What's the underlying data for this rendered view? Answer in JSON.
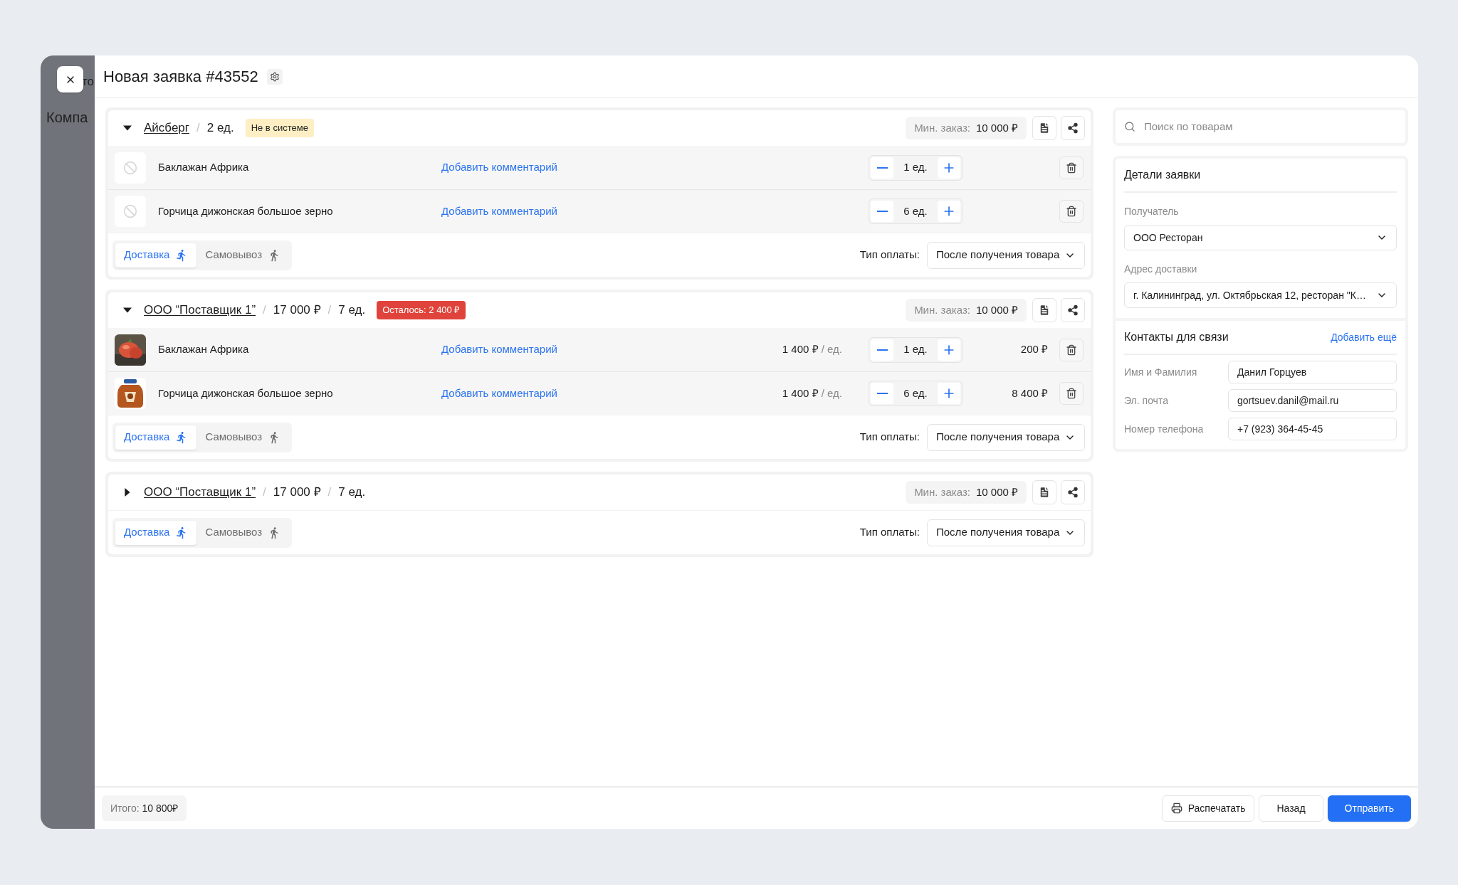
{
  "background_app": {
    "top_text": "то",
    "heading": "Компа"
  },
  "title": "Новая заявка #43552",
  "suppliers": [
    {
      "name": "Айсберг",
      "expanded": true,
      "summary": [
        {
          "separator": "/",
          "text": "2 ед."
        }
      ],
      "badge": {
        "text": "Не в системе",
        "kind": "warning"
      },
      "min_order": {
        "label": "Мин. заказ:",
        "value": "10 000 ₽"
      },
      "items": [
        {
          "name": "Баклажан Африка",
          "has_image": false,
          "comment": "Добавить комментарий",
          "qty": "1 ед."
        },
        {
          "name": "Горчица дижонская большое зерно",
          "has_image": false,
          "comment": "Добавить комментарий",
          "qty": "6 ед."
        }
      ],
      "delivery_tabs": [
        {
          "label": "Доставка",
          "selected": true,
          "kind": "run"
        },
        {
          "label": "Самовывоз",
          "selected": false,
          "kind": "walk"
        }
      ],
      "payment": {
        "label": "Тип оплаты:",
        "value": "После получения товара"
      }
    },
    {
      "name": "ООО “Поставщик 1”",
      "expanded": true,
      "summary": [
        {
          "separator": "/",
          "text": "17 000 ₽"
        },
        {
          "separator": "/",
          "text": "7 ед."
        }
      ],
      "badge": {
        "text": "Осталось: 2 400 ₽",
        "kind": "danger"
      },
      "min_order": {
        "label": "Мин. заказ:",
        "value": "10 000 ₽"
      },
      "items": [
        {
          "name": "Баклажан Африка",
          "has_image": true,
          "comment": "Добавить комментарий",
          "price": "1 400 ₽",
          "per_unit": "/ ед.",
          "qty": "1 ед.",
          "total": "200 ₽"
        },
        {
          "name": "Горчица дижонская большое зерно",
          "has_image": true,
          "comment": "Добавить комментарий",
          "price": "1 400 ₽",
          "per_unit": "/ ед.",
          "qty": "6 ед.",
          "total": "8 400 ₽"
        }
      ],
      "delivery_tabs": [
        {
          "label": "Доставка",
          "selected": true,
          "kind": "run"
        },
        {
          "label": "Самовывоз",
          "selected": false,
          "kind": "walk"
        }
      ],
      "payment": {
        "label": "Тип оплаты:",
        "value": "После получения товара"
      }
    },
    {
      "name": "ООО “Поставщик 1”",
      "expanded": false,
      "summary": [
        {
          "separator": "/",
          "text": "17 000 ₽"
        },
        {
          "separator": "/",
          "text": "7 ед."
        }
      ],
      "min_order": {
        "label": "Мин. заказ:",
        "value": "10 000 ₽"
      },
      "delivery_tabs": [
        {
          "label": "Доставка",
          "selected": true,
          "kind": "run"
        },
        {
          "label": "Самовывоз",
          "selected": false,
          "kind": "walk"
        }
      ],
      "payment": {
        "label": "Тип оплаты:",
        "value": "После получения товара"
      }
    }
  ],
  "search": {
    "placeholder": "Поиск по товарам"
  },
  "details": {
    "title": "Детали заявки",
    "fields": [
      {
        "label": "Получатель",
        "value": "ООО Ресторан"
      },
      {
        "label": "Адрес доставки",
        "value": "г. Калининград, ул. Октябрьская 12, ресторан \"К…"
      }
    ]
  },
  "contacts": {
    "title": "Контакты для связи",
    "add_link": "Добавить ещё",
    "fields": [
      {
        "label": "Имя и Фамилия",
        "value": "Данил Горцуев"
      },
      {
        "label": "Эл. почта",
        "value": "gortsuev.danil@mail.ru"
      },
      {
        "label": "Номер телефона",
        "value": "+7 (923) 364-45-45"
      }
    ]
  },
  "footer": {
    "total_label": "Итого:",
    "total_value": "10 800₽",
    "buttons": [
      {
        "label": "Распечатать",
        "kind": "print"
      },
      {
        "label": "Назад",
        "kind": "secondary"
      },
      {
        "label": "Отправить",
        "kind": "primary"
      }
    ]
  }
}
